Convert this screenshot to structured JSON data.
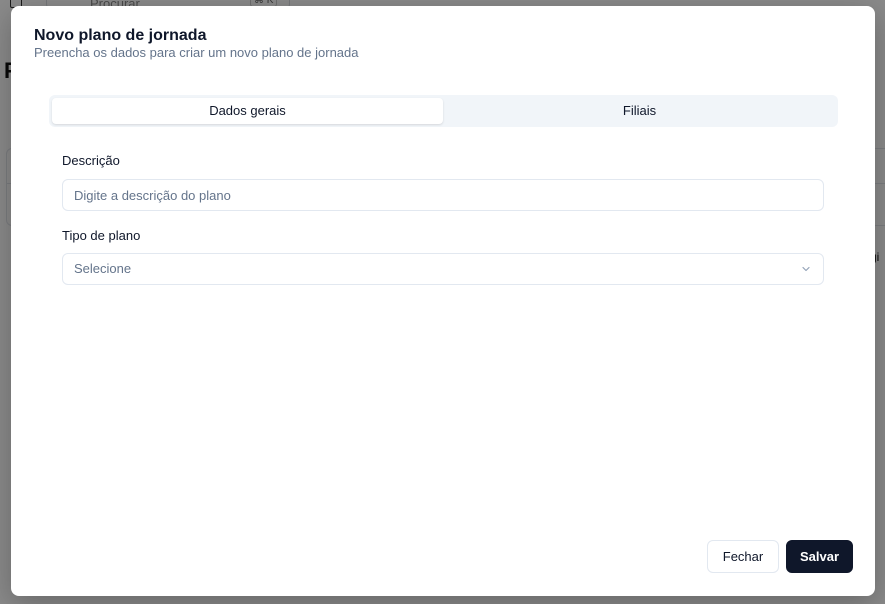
{
  "background": {
    "search_placeholder": "Procurar",
    "shortcut_hint": "⌘ K",
    "page_title_fragment": "P",
    "pagination_fragment": "gi"
  },
  "modal": {
    "title": "Novo plano de jornada",
    "subtitle": "Preencha os dados para criar um novo plano de jornada",
    "tabs": [
      {
        "label": "Dados gerais",
        "active": true
      },
      {
        "label": "Filiais",
        "active": false
      }
    ],
    "form": {
      "descricao_label": "Descrição",
      "descricao_placeholder": "Digite a descrição do plano",
      "descricao_value": "",
      "tipo_label": "Tipo de plano",
      "tipo_selected": "Selecione"
    },
    "buttons": {
      "close_label": "Fechar",
      "save_label": "Salvar"
    }
  },
  "colors": {
    "primary": "#0f172a",
    "muted_text": "#64748b",
    "border": "#e2e8f0",
    "tab_bg": "#f1f5f9"
  }
}
